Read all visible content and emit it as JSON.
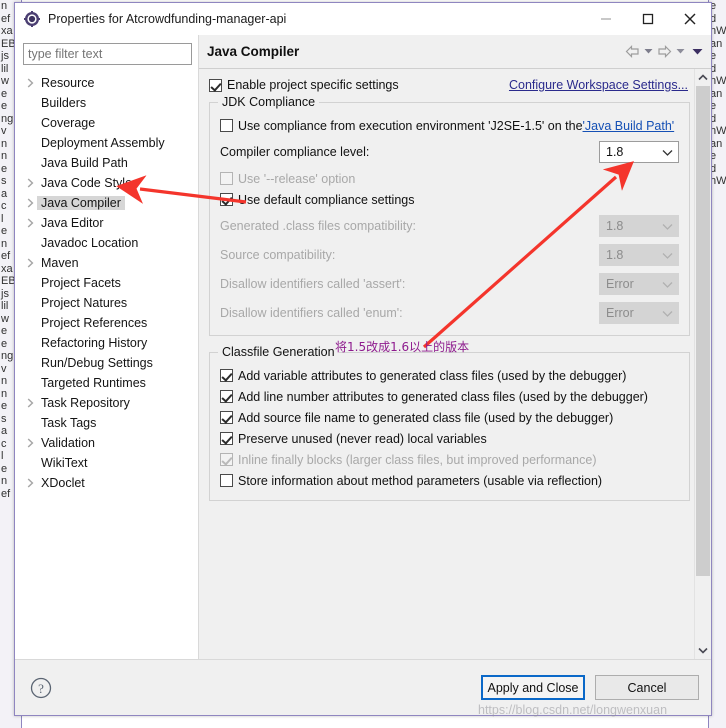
{
  "window": {
    "title": "Properties for Atcrowdfunding-manager-api",
    "icon": "eclipse-properties-icon",
    "controls": {
      "minimize": "minimize-icon",
      "maximize": "maximize-icon",
      "close": "close-icon"
    }
  },
  "filter": {
    "placeholder": "type filter text",
    "value": ""
  },
  "tree": {
    "items": [
      {
        "label": "Resource",
        "expandable": true,
        "selected": false
      },
      {
        "label": "Builders",
        "expandable": false,
        "selected": false
      },
      {
        "label": "Coverage",
        "expandable": false,
        "selected": false
      },
      {
        "label": "Deployment Assembly",
        "expandable": false,
        "selected": false
      },
      {
        "label": "Java Build Path",
        "expandable": false,
        "selected": false
      },
      {
        "label": "Java Code Style",
        "expandable": true,
        "selected": false
      },
      {
        "label": "Java Compiler",
        "expandable": true,
        "selected": true
      },
      {
        "label": "Java Editor",
        "expandable": true,
        "selected": false
      },
      {
        "label": "Javadoc Location",
        "expandable": false,
        "selected": false
      },
      {
        "label": "Maven",
        "expandable": true,
        "selected": false
      },
      {
        "label": "Project Facets",
        "expandable": false,
        "selected": false
      },
      {
        "label": "Project Natures",
        "expandable": false,
        "selected": false
      },
      {
        "label": "Project References",
        "expandable": false,
        "selected": false
      },
      {
        "label": "Refactoring History",
        "expandable": false,
        "selected": false
      },
      {
        "label": "Run/Debug Settings",
        "expandable": false,
        "selected": false
      },
      {
        "label": "Targeted Runtimes",
        "expandable": false,
        "selected": false
      },
      {
        "label": "Task Repository",
        "expandable": true,
        "selected": false
      },
      {
        "label": "Task Tags",
        "expandable": false,
        "selected": false
      },
      {
        "label": "Validation",
        "expandable": true,
        "selected": false
      },
      {
        "label": "WikiText",
        "expandable": false,
        "selected": false
      },
      {
        "label": "XDoclet",
        "expandable": true,
        "selected": false
      }
    ]
  },
  "page": {
    "title": "Java Compiler",
    "nav": {
      "back": "back-arrow-icon",
      "back_menu": "chevron-down-icon",
      "forward": "forward-arrow-icon",
      "forward_menu": "chevron-down-icon",
      "view_menu": "chevron-down-icon"
    },
    "enable_project_specific": {
      "label": "Enable project specific settings",
      "checked": true
    },
    "configure_workspace_link": "Configure Workspace Settings...",
    "jdk_compliance": {
      "title": "JDK Compliance",
      "use_execution_env": {
        "text_before": "Use compliance from execution environment 'J2SE-1.5' on the ",
        "link": "'Java Build Path'",
        "checked": false
      },
      "compliance_level": {
        "label": "Compiler compliance level:",
        "value": "1.8",
        "enabled": true
      },
      "use_release_option": {
        "label": "Use '--release' option",
        "checked": false,
        "enabled": false
      },
      "use_default_compliance": {
        "label": "Use default compliance settings",
        "checked": true,
        "enabled": true
      },
      "rows": [
        {
          "label": "Generated .class files compatibility:",
          "value": "1.8",
          "enabled": false
        },
        {
          "label": "Source compatibility:",
          "value": "1.8",
          "enabled": false
        },
        {
          "label": "Disallow identifiers called 'assert':",
          "value": "Error",
          "enabled": false
        },
        {
          "label": "Disallow identifiers called 'enum':",
          "value": "Error",
          "enabled": false
        }
      ]
    },
    "classfile_generation": {
      "title": "Classfile Generation",
      "options": [
        {
          "label": "Add variable attributes to generated class files (used by the debugger)",
          "checked": true,
          "enabled": true
        },
        {
          "label": "Add line number attributes to generated class files (used by the debugger)",
          "checked": true,
          "enabled": true
        },
        {
          "label": "Add source file name to generated class file (used by the debugger)",
          "checked": true,
          "enabled": true
        },
        {
          "label": "Preserve unused (never read) local variables",
          "checked": true,
          "enabled": true
        },
        {
          "label": "Inline finally blocks (larger class files, but improved performance)",
          "checked": true,
          "enabled": false
        },
        {
          "label": "Store information about method parameters (usable via reflection)",
          "checked": false,
          "enabled": true
        }
      ]
    }
  },
  "footer": {
    "help": "help-icon",
    "apply_and_close": "Apply and Close",
    "cancel": "Cancel"
  },
  "annotations": {
    "note_cn": "将1.5改成1.6以上的版本",
    "arrow_color": "#f4352c",
    "watermark": "https://blog.csdn.net/longwenxuan"
  },
  "background_window": {
    "left_strips": [
      "n",
      "ef",
      "",
      "",
      "",
      "xa",
      "",
      "EB",
      "js",
      "",
      "",
      "",
      "lil",
      "w",
      "e",
      "e",
      "",
      "",
      "ng",
      "v",
      "n",
      "n",
      "e",
      "s",
      "a",
      "c",
      "l",
      "e"
    ],
    "right_strips": [
      "",
      "",
      "",
      "e",
      "",
      "d",
      "",
      "",
      "",
      "",
      "",
      "",
      "",
      "hW",
      "an"
    ]
  }
}
